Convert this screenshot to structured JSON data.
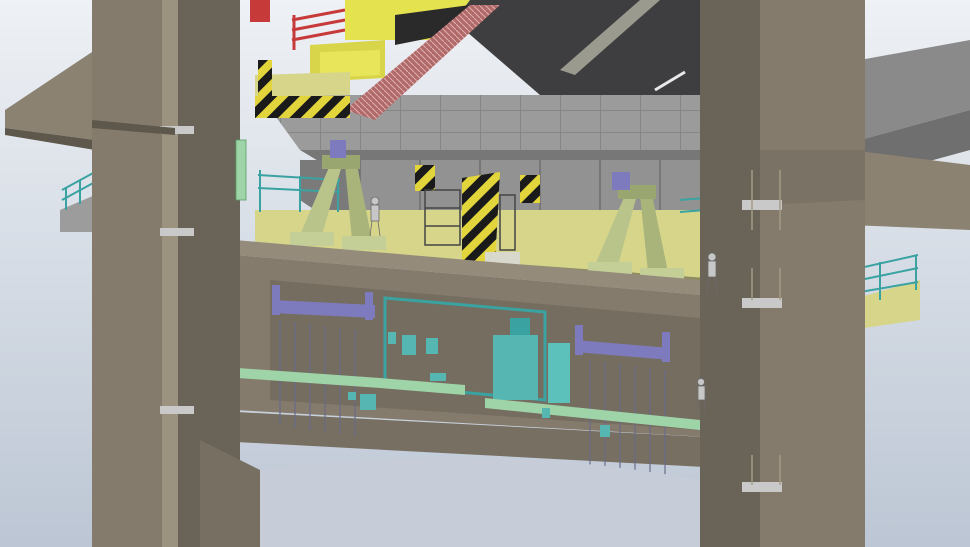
{
  "scene": {
    "colors": {
      "sky_top": "#eef1f5",
      "sky_bottom": "#bcc6d4",
      "concrete": "#847b6c",
      "concrete_dark": "#5e574c",
      "concrete_light": "#a59d8f",
      "deck_gray": "#8d8d8d",
      "deck_light": "#a9a9a9",
      "road": "#3e3e40",
      "platform_yellow": "#d6d58a",
      "crane_yellow": "#e5e24f",
      "railing_teal": "#3aa3a2",
      "equipment_teal": "#55b6b2",
      "support_green": "#b8c48a",
      "beam_purple": "#7d7bbd",
      "hazard_black": "#1a1a1a",
      "hazard_yellow": "#e2d53c",
      "red_net": "#c35a5a"
    },
    "components": [
      "left-pier",
      "right-pier",
      "cross-beam",
      "box-girder-segment",
      "lifting-frame",
      "gantry-crane",
      "work-platform",
      "hydraulic-supports",
      "equipment-room",
      "workers"
    ]
  }
}
